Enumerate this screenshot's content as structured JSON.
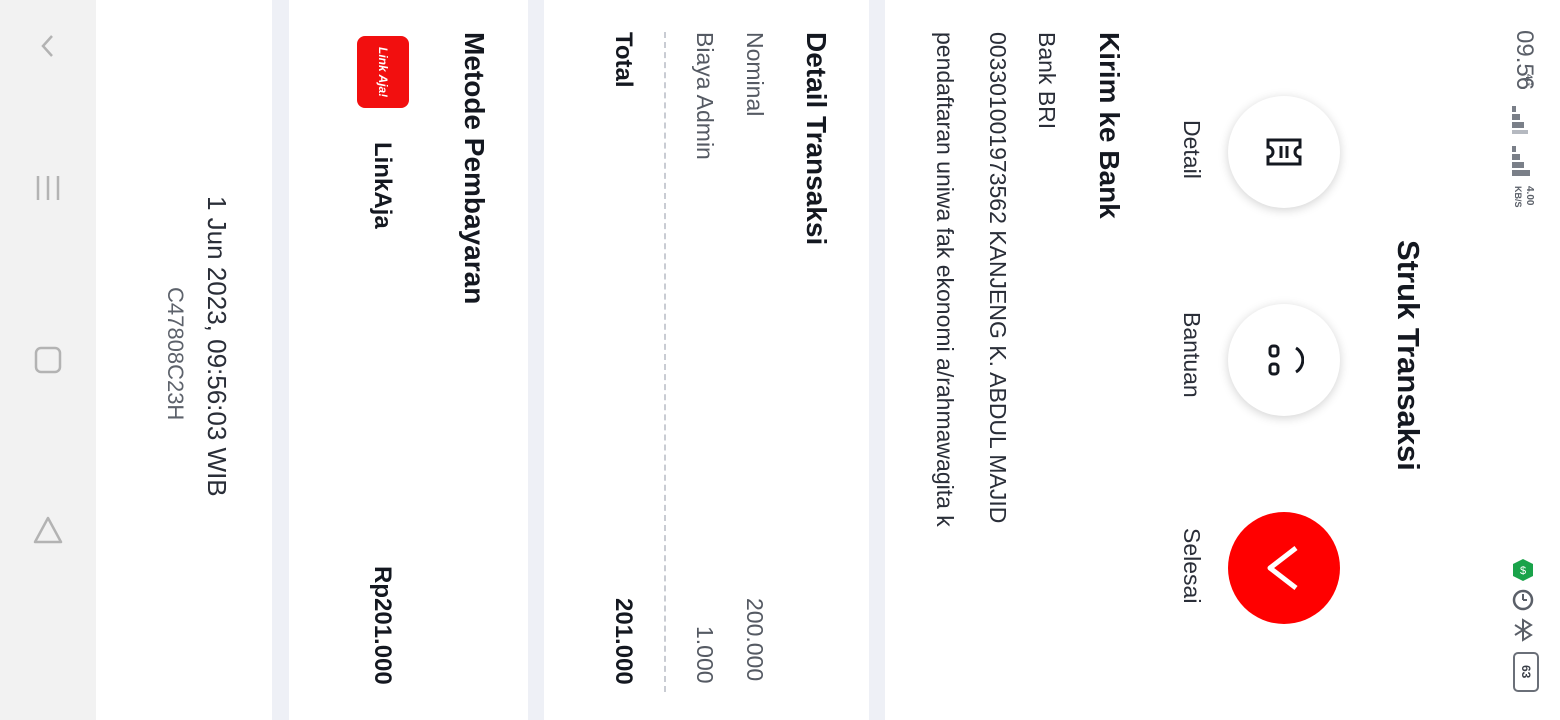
{
  "status_bar": {
    "time": "09.56",
    "network_type": "4G",
    "speed_value": "4.00",
    "speed_unit": "KB/S",
    "battery": "63",
    "icons": [
      "signal-icon",
      "wifi-signal-icon",
      "money-app-icon",
      "alarm-icon",
      "bluetooth-icon",
      "battery-icon"
    ]
  },
  "header": {
    "title": "Struk Transaksi"
  },
  "actions": [
    {
      "label": "Detail",
      "icon": "receipt-icon"
    },
    {
      "label": "Bantuan",
      "icon": "headset-icon"
    },
    {
      "label": "Selesai",
      "icon": "check-icon"
    }
  ],
  "recipient": {
    "heading": "Kirim ke Bank",
    "bank": "Bank BRI",
    "account": "003301001973562 KANJENG K. ABDUL MAJID",
    "note": "pendaftaran uniwa fak ekonomi  a/rahmawagita k"
  },
  "transaction_detail": {
    "heading": "Detail Transaksi",
    "rows": [
      {
        "label": "Nominal",
        "value": "200.000"
      },
      {
        "label": "Biaya Admin",
        "value": "1.000"
      }
    ],
    "total_label": "Total",
    "total_value": "201.000"
  },
  "payment": {
    "heading": "Metode Pembayaran",
    "logo_text": "Link Aja!",
    "method": "LinkAja",
    "amount": "Rp201.000"
  },
  "footer": {
    "datetime": "1 Jun 2023, 09:56:03 WIB",
    "reference": "C47808C23H"
  },
  "colors": {
    "accent": "#ff0000",
    "background": "#ffffff",
    "gutter": "#eef0f6",
    "navbar": "#f2f2f2",
    "text": "#141820"
  }
}
